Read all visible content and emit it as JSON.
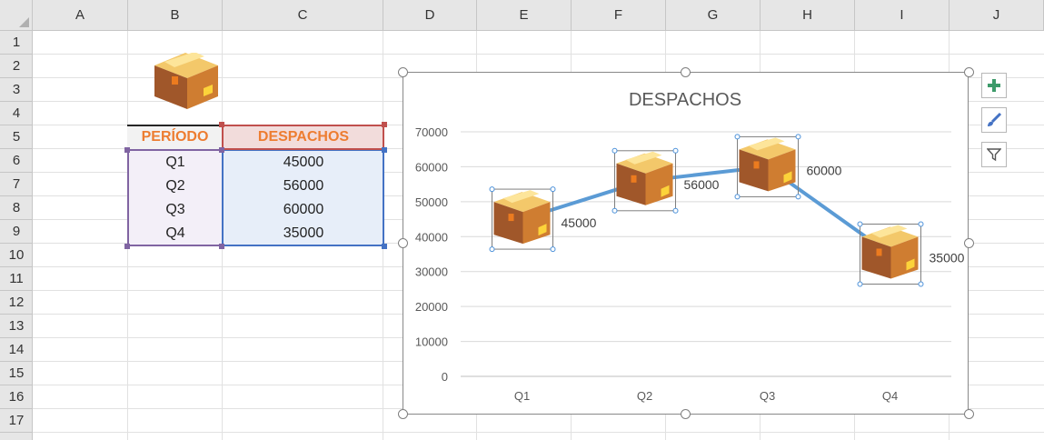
{
  "sheet": {
    "columns": [
      "A",
      "B",
      "C",
      "D",
      "E",
      "F",
      "G",
      "H",
      "I",
      "J"
    ],
    "rows": [
      "1",
      "2",
      "3",
      "4",
      "5",
      "6",
      "7",
      "8",
      "9",
      "10",
      "11",
      "12",
      "13",
      "14",
      "15",
      "16",
      "17"
    ]
  },
  "table": {
    "header_periodo": "PERÍODO",
    "header_despachos": "DESPACHOS",
    "rows": [
      {
        "periodo": "Q1",
        "despachos": "45000"
      },
      {
        "periodo": "Q2",
        "despachos": "56000"
      },
      {
        "periodo": "Q3",
        "despachos": "60000"
      },
      {
        "periodo": "Q4",
        "despachos": "35000"
      }
    ],
    "header_color": "#ed7d31"
  },
  "chart_data": {
    "type": "line",
    "title": "DESPACHOS",
    "categories": [
      "Q1",
      "Q2",
      "Q3",
      "Q4"
    ],
    "values": [
      45000,
      56000,
      60000,
      35000
    ],
    "data_labels": [
      "45000",
      "56000",
      "60000",
      "35000"
    ],
    "ylim": [
      0,
      70000
    ],
    "y_ticks": [
      "0",
      "10000",
      "20000",
      "30000",
      "40000",
      "50000",
      "60000",
      "70000"
    ],
    "grid": true,
    "marker": "box-icon",
    "line_color": "#5b9bd5"
  },
  "chart_tools": {
    "add_icon": "plus-icon",
    "style_icon": "brush-icon",
    "filter_icon": "filter-icon"
  }
}
